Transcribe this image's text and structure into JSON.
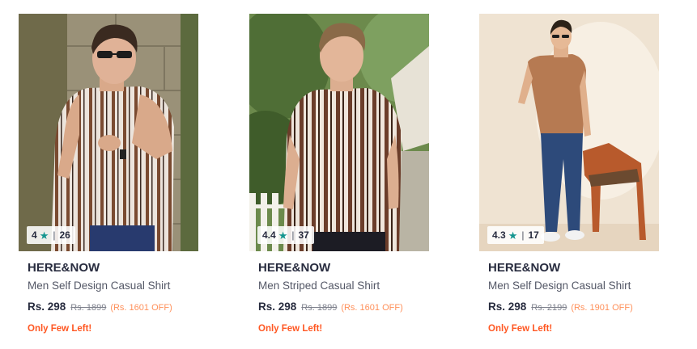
{
  "products": [
    {
      "image": "man-in-vertical-striped-shirt-against-stone-wall",
      "rating": "4",
      "rating_count": "26",
      "brand": "HERE&NOW",
      "title": "Men Self Design Casual Shirt",
      "price": "Rs. 298",
      "mrp": "Rs. 1899",
      "discount": "(Rs. 1601 OFF)",
      "stock_note": "Only Few Left!"
    },
    {
      "image": "man-in-vertical-striped-shirt-with-palm-trees",
      "rating": "4.4",
      "rating_count": "37",
      "brand": "HERE&NOW",
      "title": "Men Striped Casual Shirt",
      "price": "Rs. 298",
      "mrp": "Rs. 1899",
      "discount": "(Rs. 1601 OFF)",
      "stock_note": "Only Few Left!"
    },
    {
      "image": "man-in-brown-shirt-and-jeans-beside-wooden-chair",
      "rating": "4.3",
      "rating_count": "17",
      "brand": "HERE&NOW",
      "title": "Men Self Design Casual Shirt",
      "price": "Rs. 298",
      "mrp": "Rs. 2199",
      "discount": "(Rs. 1901 OFF)",
      "stock_note": "Only Few Left!"
    }
  ],
  "colors": {
    "rating_star": "#14958f",
    "discount": "#ff905a",
    "stock_note": "#ff5722",
    "brand_text": "#282c3f",
    "muted_text": "#535766"
  },
  "icons": {
    "rating": "star-icon"
  }
}
